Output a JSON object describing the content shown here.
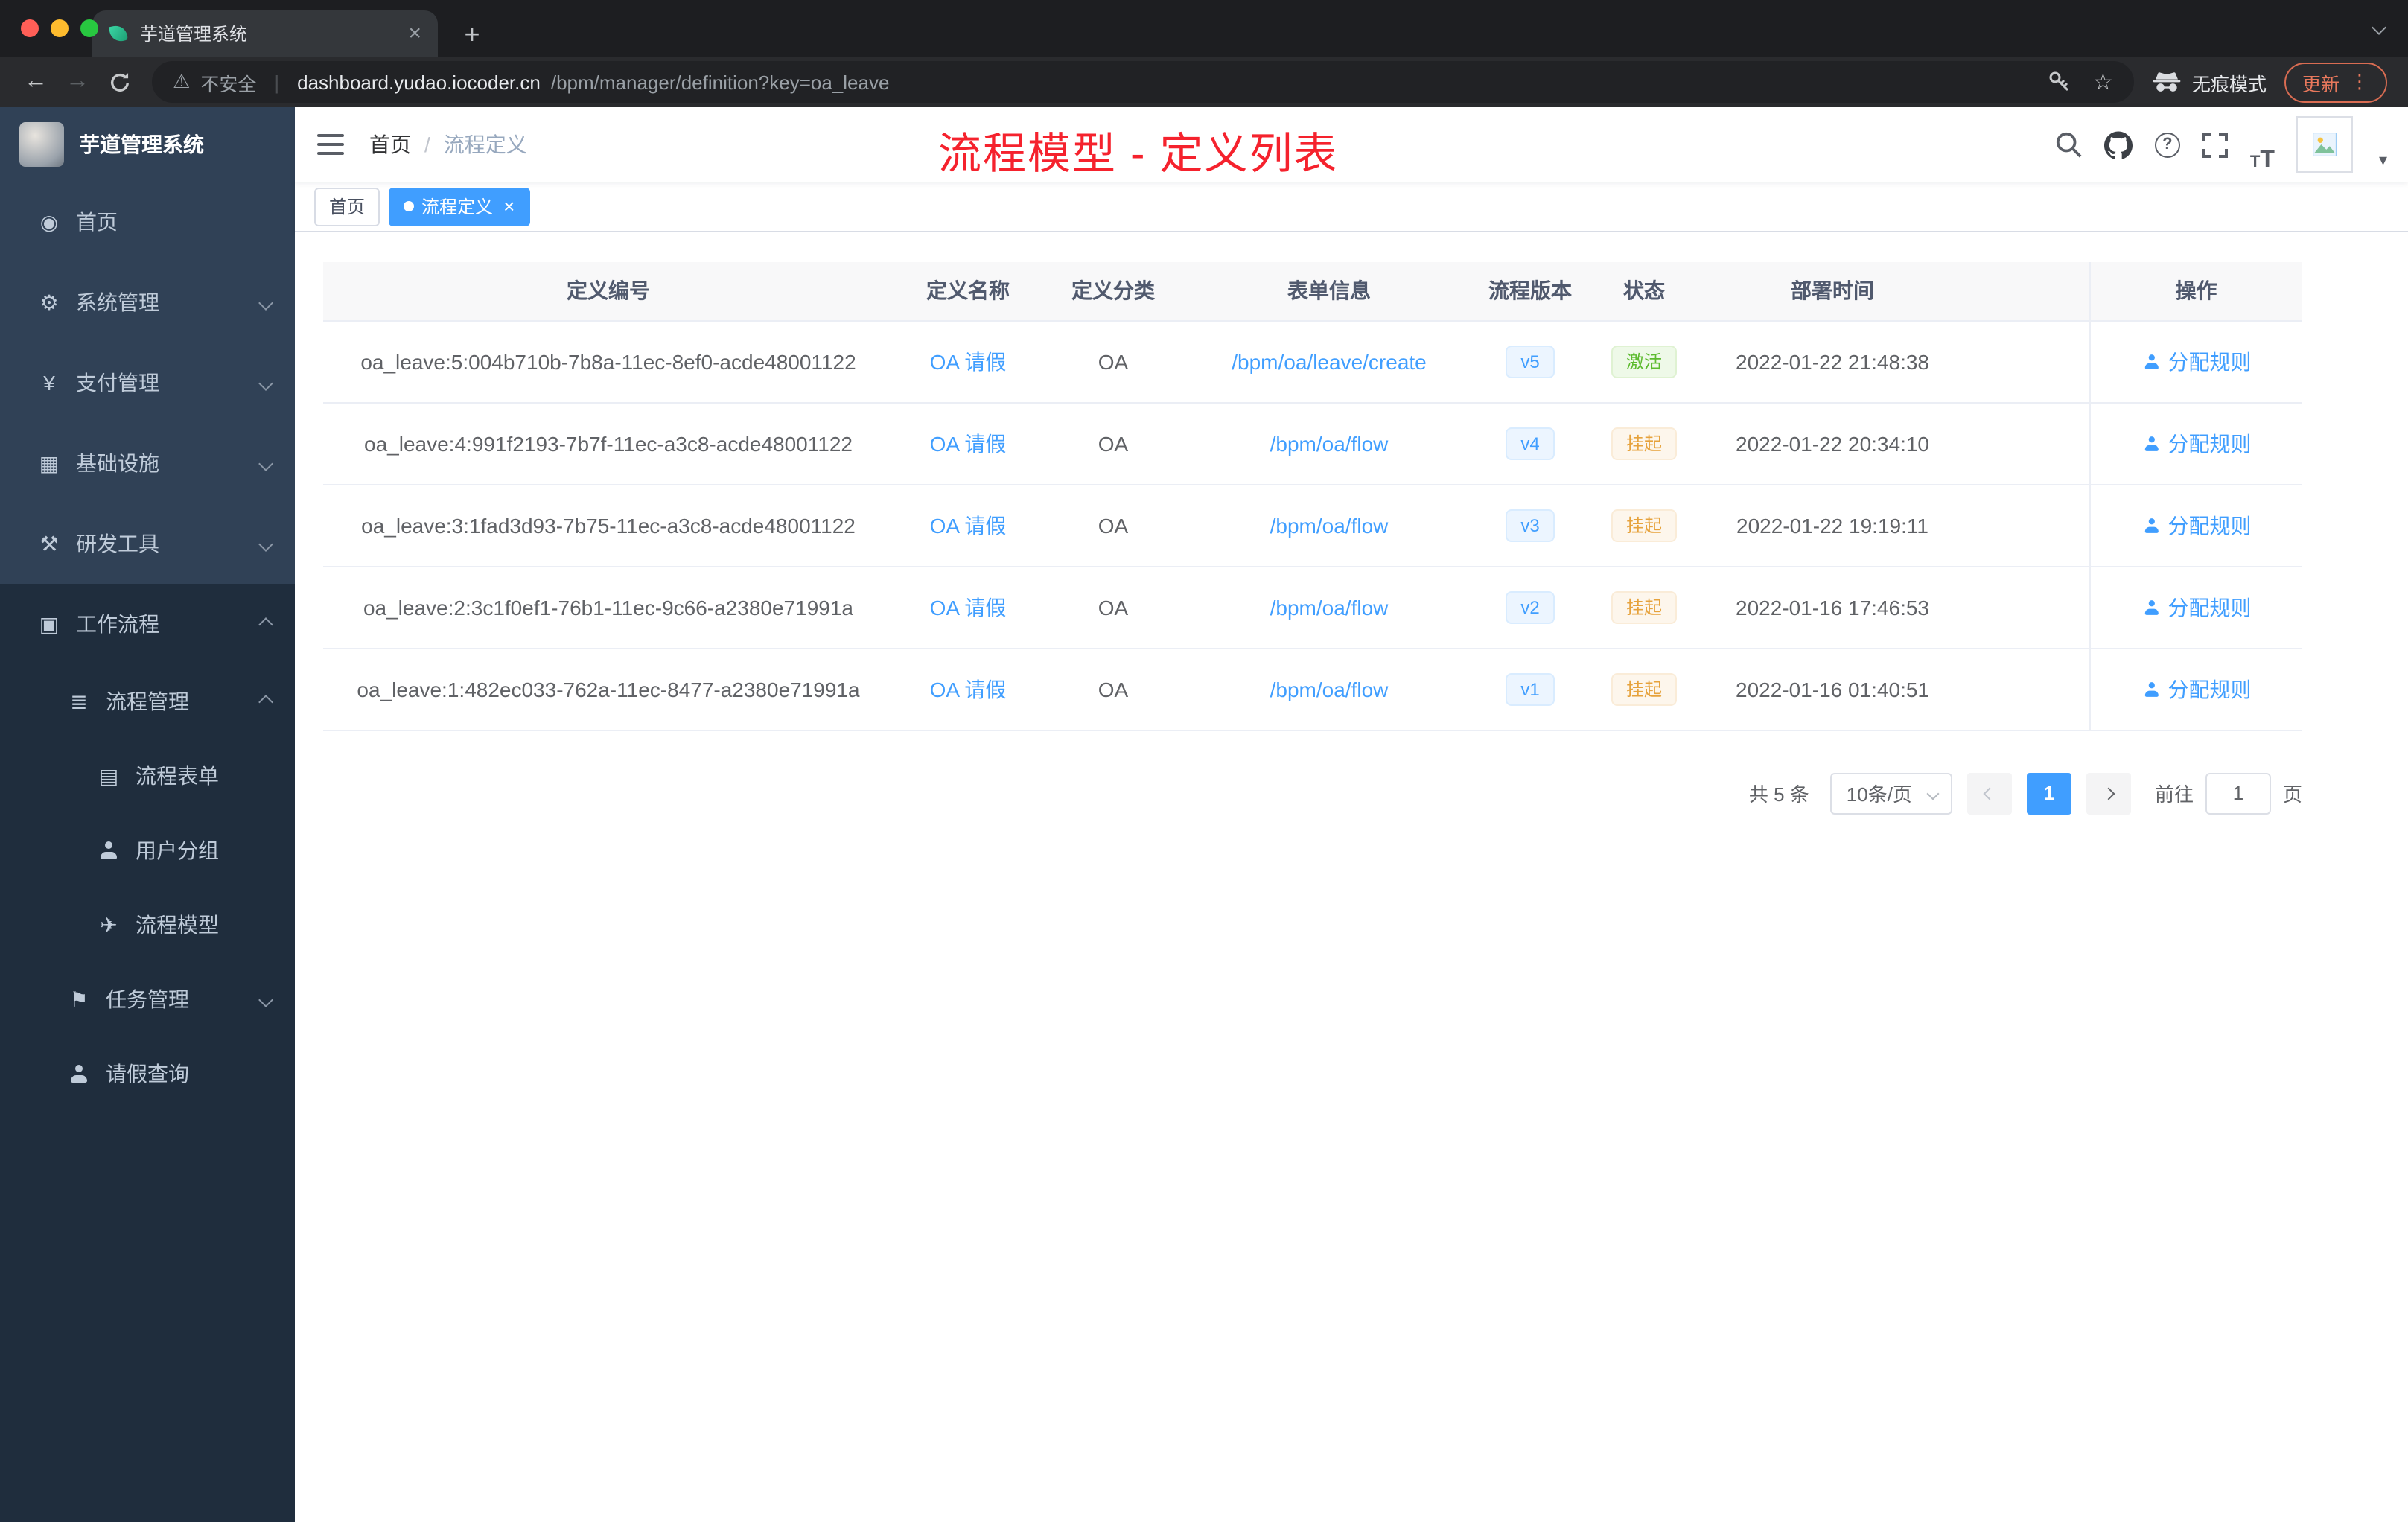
{
  "browser": {
    "tab_title": "芋道管理系统",
    "security_label": "不安全",
    "url_domain": "dashboard.yudao.iocoder.cn",
    "url_path": "/bpm/manager/definition?key=oa_leave",
    "incognito_label": "无痕模式",
    "update_label": "更新"
  },
  "sidebar": {
    "logo_title": "芋道管理系统",
    "items": [
      {
        "key": "home",
        "label": "首页",
        "icon": "dashboard-icon",
        "level": 1,
        "chevron": null,
        "dark": false
      },
      {
        "key": "system-management",
        "label": "系统管理",
        "icon": "gear-icon",
        "level": 1,
        "chevron": "down",
        "dark": false
      },
      {
        "key": "payment-management",
        "label": "支付管理",
        "icon": "yen-icon",
        "level": 1,
        "chevron": "down",
        "dark": false
      },
      {
        "key": "infrastructure",
        "label": "基础设施",
        "icon": "infrastructure-icon",
        "level": 1,
        "chevron": "down",
        "dark": false
      },
      {
        "key": "dev-tools",
        "label": "研发工具",
        "icon": "devtools-icon",
        "level": 1,
        "chevron": "down",
        "dark": false
      },
      {
        "key": "workflow",
        "label": "工作流程",
        "icon": "workflow-icon",
        "level": 1,
        "chevron": "up",
        "dark": true
      },
      {
        "key": "process-management",
        "label": "流程管理",
        "icon": "process-list-icon",
        "level": 2,
        "chevron": "up",
        "dark": true
      },
      {
        "key": "process-form",
        "label": "流程表单",
        "icon": "form-icon",
        "level": 3,
        "chevron": null,
        "dark": true
      },
      {
        "key": "user-group",
        "label": "用户分组",
        "icon": "user-group-icon",
        "level": 3,
        "chevron": null,
        "dark": true
      },
      {
        "key": "process-model",
        "label": "流程模型",
        "icon": "paper-plane-icon",
        "level": 3,
        "chevron": null,
        "dark": true
      },
      {
        "key": "task-management",
        "label": "任务管理",
        "icon": "task-icon",
        "level": 2,
        "chevron": "down",
        "dark": true
      },
      {
        "key": "leave-query",
        "label": "请假查询",
        "icon": "person-icon",
        "level": 2,
        "chevron": null,
        "dark": true
      }
    ]
  },
  "header": {
    "breadcrumb": [
      "首页",
      "流程定义"
    ],
    "breadcrumb_separator": "/",
    "annotation": "流程模型 - 定义列表",
    "icons": [
      "search-icon",
      "github-icon",
      "help-icon",
      "fullscreen-icon",
      "font-size-icon",
      "avatar",
      "caret-down-icon"
    ]
  },
  "tags": [
    {
      "key": "home",
      "label": "首页",
      "active": false,
      "closable": false
    },
    {
      "key": "process-definition",
      "label": "流程定义",
      "active": true,
      "closable": true
    }
  ],
  "table": {
    "columns": [
      "定义编号",
      "定义名称",
      "定义分类",
      "表单信息",
      "流程版本",
      "状态",
      "部署时间",
      "操作"
    ],
    "rows": [
      {
        "id": "oa_leave:5:004b710b-7b8a-11ec-8ef0-acde48001122",
        "name": "OA 请假",
        "category": "OA",
        "form": "/bpm/oa/leave/create",
        "version": "v5",
        "status": "激活",
        "status_type": "success",
        "time": "2022-01-22 21:48:38",
        "action": "分配规则"
      },
      {
        "id": "oa_leave:4:991f2193-7b7f-11ec-a3c8-acde48001122",
        "name": "OA 请假",
        "category": "OA",
        "form": "/bpm/oa/flow",
        "version": "v4",
        "status": "挂起",
        "status_type": "warning",
        "time": "2022-01-22 20:34:10",
        "action": "分配规则"
      },
      {
        "id": "oa_leave:3:1fad3d93-7b75-11ec-a3c8-acde48001122",
        "name": "OA 请假",
        "category": "OA",
        "form": "/bpm/oa/flow",
        "version": "v3",
        "status": "挂起",
        "status_type": "warning",
        "time": "2022-01-22 19:19:11",
        "action": "分配规则"
      },
      {
        "id": "oa_leave:2:3c1f0ef1-76b1-11ec-9c66-a2380e71991a",
        "name": "OA 请假",
        "category": "OA",
        "form": "/bpm/oa/flow",
        "version": "v2",
        "status": "挂起",
        "status_type": "warning",
        "time": "2022-01-16 17:46:53",
        "action": "分配规则"
      },
      {
        "id": "oa_leave:1:482ec033-762a-11ec-8477-a2380e71991a",
        "name": "OA 请假",
        "category": "OA",
        "form": "/bpm/oa/flow",
        "version": "v1",
        "status": "挂起",
        "status_type": "warning",
        "time": "2022-01-16 01:40:51",
        "action": "分配规则"
      }
    ]
  },
  "pagination": {
    "total": "共 5 条",
    "page_size": "10条/页",
    "current_page": "1",
    "goto_label": "前往",
    "goto_value": "1",
    "goto_suffix": "页"
  },
  "colors": {
    "accent": "#409EFF",
    "success": "#5dbb2f",
    "warning": "#e6a23c",
    "annotation_red": "#f5222d",
    "sidebar": "#304156",
    "sidebar_dark": "#1f2d3d",
    "traffic_lights": [
      "#ff5f57",
      "#febc2e",
      "#28c840"
    ]
  }
}
